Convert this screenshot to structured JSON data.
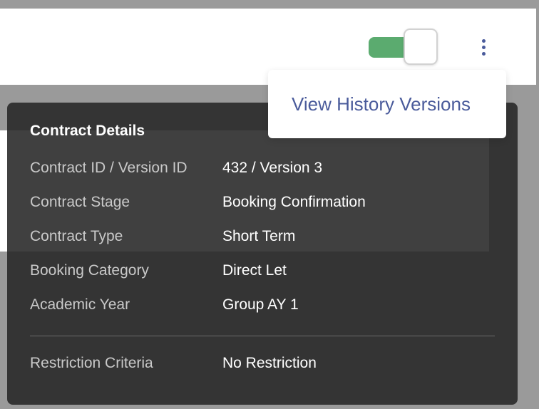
{
  "colors": {
    "toggle_on": "#5bab6f",
    "accent_blue": "#4a5b9b",
    "panel_bg": "#3b3b3b",
    "backdrop": "#9a9a9a"
  },
  "header": {
    "toggle": {
      "state": "on"
    },
    "more_menu_icon": "vertical-ellipsis-icon"
  },
  "menu": {
    "items": [
      {
        "label": "View History Versions"
      }
    ]
  },
  "details": {
    "title": "Contract Details",
    "rows": [
      {
        "label": "Contract ID / Version ID",
        "value": "432 / Version 3"
      },
      {
        "label": "Contract Stage",
        "value": "Booking Confirmation"
      },
      {
        "label": "Contract Type",
        "value": "Short Term"
      },
      {
        "label": "Booking Category",
        "value": "Direct Let"
      },
      {
        "label": "Academic Year",
        "value": "Group AY 1"
      }
    ],
    "extra_rows": [
      {
        "label": "Restriction Criteria",
        "value": "No Restriction"
      }
    ]
  }
}
